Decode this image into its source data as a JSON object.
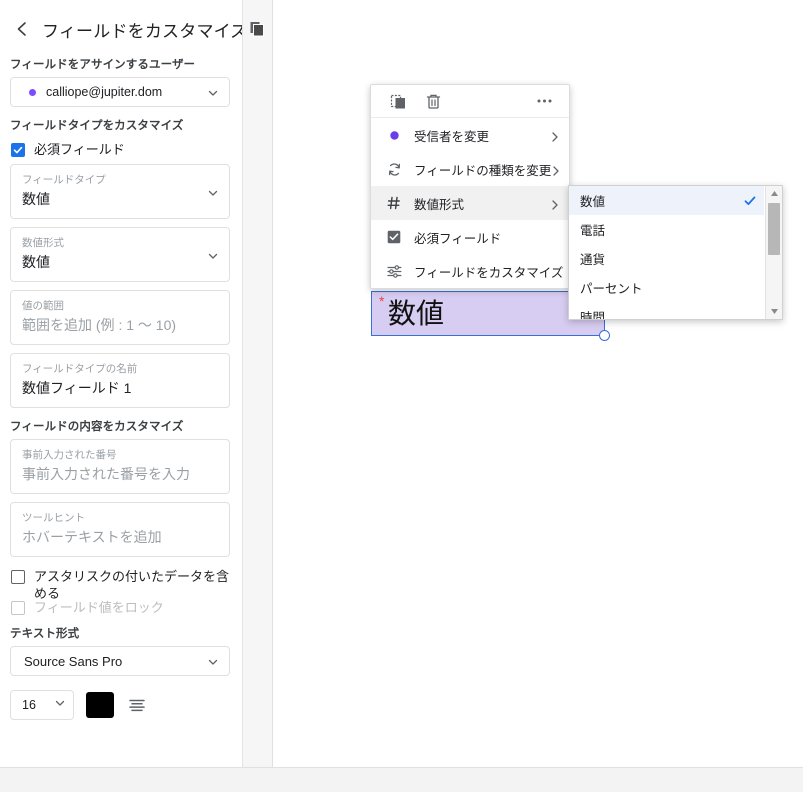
{
  "panel": {
    "title": "フィールドをカスタマイズ",
    "back_icon": "chevron-left-icon",
    "assign_section_label": "フィールドをアサインするユーザー",
    "assignee": {
      "email": "calliope@jupiter.dom",
      "dot_color": "#7c4dff",
      "caret_icon": "chevron-down-icon"
    },
    "fieldtype_section_label": "フィールドタイプをカスタマイズ",
    "required_checkbox": {
      "label": "必須フィールド",
      "checked": true,
      "color": "#1a73e8"
    },
    "field_type": {
      "label": "フィールドタイプ",
      "value": "数値"
    },
    "number_format": {
      "label": "数値形式",
      "value": "数値"
    },
    "value_range": {
      "label": "値の範囲",
      "placeholder": "範囲を追加 (例 : 1 〜 10)"
    },
    "field_type_name": {
      "label": "フィールドタイプの名前",
      "value": "数値フィールド 1"
    },
    "content_section_label": "フィールドの内容をカスタマイズ",
    "prefill": {
      "label": "事前入力された番号",
      "placeholder": "事前入力された番号を入力"
    },
    "tooltip": {
      "label": "ツールヒント",
      "placeholder": "ホバーテキストを追加"
    },
    "include_asterisk_checkbox": {
      "label": "アスタリスクの付いたデータを含める",
      "checked": false
    },
    "lock_value_checkbox": {
      "label": "フィールド値をロック",
      "checked": false,
      "disabled": true
    },
    "text_format_label": "テキスト形式",
    "font_select": {
      "value": "Source Sans Pro"
    },
    "font_size_select": {
      "value": "16"
    },
    "text_color": {
      "value": "#000000"
    },
    "align_icon": "text-align-icon"
  },
  "pages_strip": {
    "icon": "pages-icon"
  },
  "context_menu": {
    "toolbar": {
      "duplicate_icon": "duplicate-icon",
      "delete_icon": "trash-icon",
      "more_icon": "more-horizontal-icon"
    },
    "items": [
      {
        "icon": "person-dot-icon",
        "label": "受信者を変更",
        "arrow": true,
        "active": false
      },
      {
        "icon": "sync-icon",
        "label": "フィールドの種類を変更",
        "arrow": true,
        "active": false
      },
      {
        "icon": "hash-icon",
        "label": "数値形式",
        "arrow": true,
        "active": true
      },
      {
        "icon": "checkbox-checked-icon",
        "label": "必須フィールド",
        "arrow": false,
        "active": false
      },
      {
        "icon": "tune-icon",
        "label": "フィールドをカスタマイズ",
        "arrow": false,
        "active": false
      }
    ]
  },
  "submenu": {
    "items": [
      {
        "label": "数値",
        "selected": true
      },
      {
        "label": "電話",
        "selected": false
      },
      {
        "label": "通貨",
        "selected": false
      },
      {
        "label": "パーセント",
        "selected": false
      },
      {
        "label": "時間",
        "selected": false
      }
    ],
    "check_icon": "check-icon",
    "scrollbar": {
      "up_icon": "triangle-up-icon",
      "down_icon": "triangle-down-icon"
    }
  },
  "field_widget": {
    "asterisk": "*",
    "text": "数値",
    "fill_color": "#d7cdf2",
    "border_color": "#3b6fd4"
  }
}
